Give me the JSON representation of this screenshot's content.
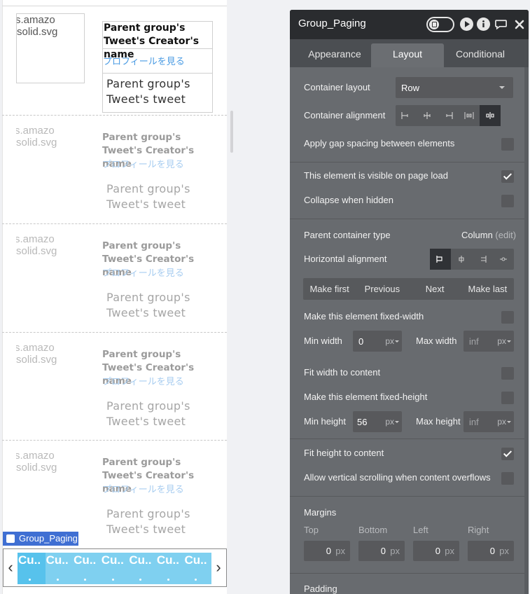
{
  "canvas": {
    "tweets": [
      {
        "avatar_line1": "s.amazo",
        "avatar_line2": "solid.svg",
        "creator": "Parent group's Tweet's Creator's name",
        "profile_link": "プロフィールを見る",
        "tweet": "Parent group's Tweet's tweet"
      },
      {
        "avatar_line1": "s.amazo",
        "avatar_line2": "solid.svg",
        "creator": "Parent group's Tweet's Creator's name",
        "profile_link": "プロフィールを見る",
        "tweet": "Parent group's Tweet's tweet"
      },
      {
        "avatar_line1": "s.amazo",
        "avatar_line2": "solid.svg",
        "creator": "Parent group's Tweet's Creator's name",
        "profile_link": "プロフィールを見る",
        "tweet": "Parent group's Tweet's tweet"
      },
      {
        "avatar_line1": "s.amazo",
        "avatar_line2": "solid.svg",
        "creator": "Parent group's Tweet's Creator's name",
        "profile_link": "プロフィールを見る",
        "tweet": "Parent group's Tweet's tweet"
      },
      {
        "avatar_line1": "s.amazo",
        "avatar_line2": "solid.svg",
        "creator": "Parent group's Tweet's Creator's name",
        "profile_link": "プロフィールを見る",
        "tweet": "Parent group's Tweet's tweet"
      }
    ],
    "group_tag": "Group_Paging",
    "paging": {
      "prev_arrow": "‹",
      "next_arrow": "›",
      "items": [
        "Cu..",
        "Cu..",
        "Cu..",
        "Cu..",
        "Cu..",
        "Cu..",
        "Cu.."
      ]
    }
  },
  "panel": {
    "title": "Group_Paging",
    "header_icons": [
      "toggle-icon",
      "play-icon",
      "info-icon",
      "comment-icon",
      "close-icon"
    ],
    "tabs": [
      {
        "label": "Appearance",
        "active": false
      },
      {
        "label": "Layout",
        "active": true
      },
      {
        "label": "Conditional",
        "active": false
      }
    ],
    "container_layout": {
      "label": "Container layout",
      "value": "Row"
    },
    "container_alignment": {
      "label": "Container alignment",
      "options": [
        "align-left",
        "align-center",
        "align-right",
        "space-between",
        "space-around"
      ],
      "selected": "space-around"
    },
    "gap_spacing": {
      "label": "Apply gap spacing between elements",
      "checked": false
    },
    "visible_on_load": {
      "label": "This element is visible on page load",
      "checked": true
    },
    "collapse_hidden": {
      "label": "Collapse when hidden",
      "checked": false
    },
    "parent_container": {
      "label": "Parent container type",
      "value": "Column",
      "edit": "(edit)"
    },
    "horizontal_alignment": {
      "label": "Horizontal alignment",
      "options": [
        "align-left",
        "align-center",
        "align-right",
        "align-center-dot"
      ],
      "selected": "align-left"
    },
    "paging_nav": [
      "Make first",
      "Previous",
      "Next",
      "Make last"
    ],
    "fixed_width": {
      "label": "Make this element fixed-width",
      "checked": false
    },
    "min_width": {
      "label": "Min width",
      "value": "0",
      "unit": "px"
    },
    "max_width": {
      "label": "Max width",
      "placeholder": "inf",
      "unit": "px"
    },
    "fit_width": {
      "label": "Fit width to content",
      "checked": false
    },
    "fixed_height": {
      "label": "Make this element fixed-height",
      "checked": false
    },
    "min_height": {
      "label": "Min height",
      "value": "56",
      "unit": "px"
    },
    "max_height": {
      "label": "Max height",
      "placeholder": "inf",
      "unit": "px"
    },
    "fit_height": {
      "label": "Fit height to content",
      "checked": true
    },
    "vertical_scroll": {
      "label": "Allow vertical scrolling when content overflows",
      "checked": false
    },
    "margins": {
      "title": "Margins",
      "fields": [
        {
          "label": "Top",
          "value": "0",
          "unit": "px"
        },
        {
          "label": "Bottom",
          "value": "0",
          "unit": "px"
        },
        {
          "label": "Left",
          "value": "0",
          "unit": "px"
        },
        {
          "label": "Right",
          "value": "0",
          "unit": "px"
        }
      ]
    },
    "padding_title": "Padding"
  },
  "colors": {
    "panel_bg": "#686b6f",
    "header_bg": "#2a2c2f",
    "paging_active": "#57c2ec",
    "paging_bg": "#7fd0f0",
    "tag_blue": "#3f6fd3",
    "link_blue": "#4a9be3"
  }
}
